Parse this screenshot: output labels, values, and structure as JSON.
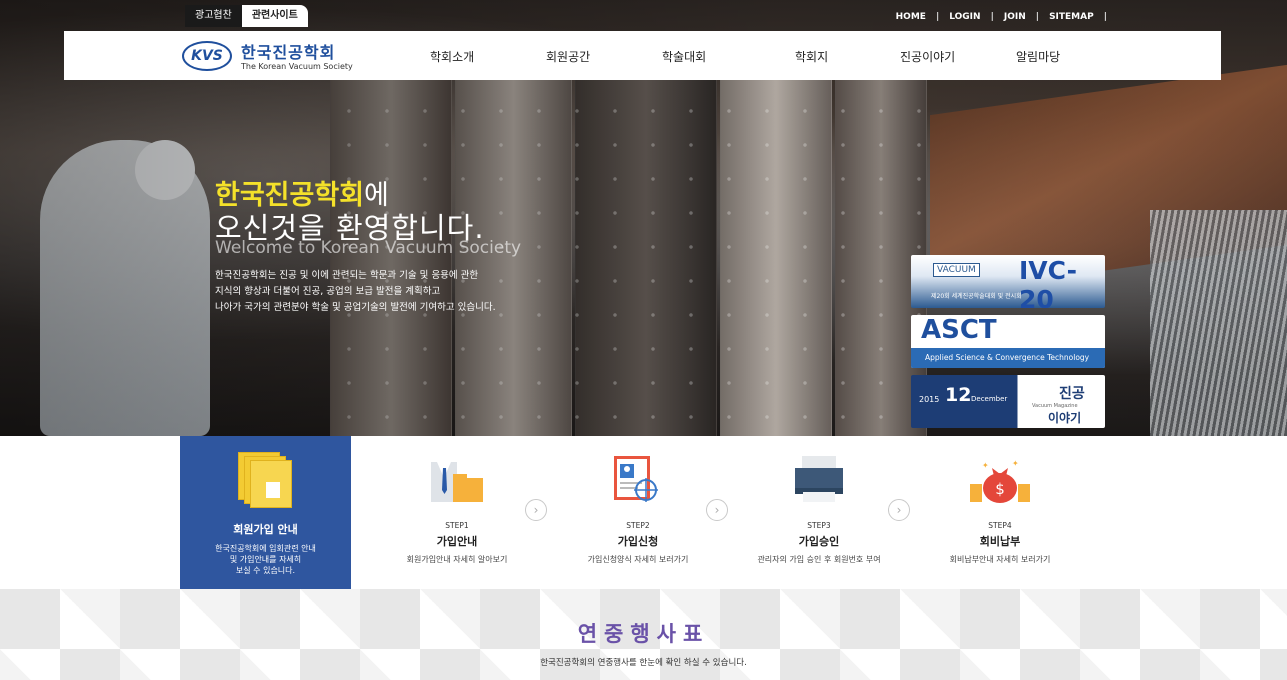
{
  "util_tabs": [
    "광고협찬",
    "관련사이트"
  ],
  "util_links": [
    "HOME",
    "LOGIN",
    "JOIN",
    "SITEMAP"
  ],
  "logo": {
    "badge": "KVS",
    "name_kr": "한국진공학회",
    "name_en": "The Korean Vacuum Society"
  },
  "nav": [
    "학회소개",
    "회원공간",
    "학술대회",
    "학회지",
    "진공이야기",
    "알림마당"
  ],
  "hero": {
    "title_highlight": "한국진공학회",
    "title_rest": "에",
    "title_line2": "오신것을 환영합니다.",
    "subtitle_en": "Welcome to Korean Vacuum Society",
    "desc": [
      "한국진공학회는 진공 및 이에 관련되는 학문과 기술 및 응용에 관한",
      "지식의 향상과 더불어 진공, 공업의 보급 발전을 계획하고",
      "나아가 국가의 관련분야 학술 및 공업기술의 발전에 기여하고 있습니다."
    ],
    "colors": {
      "highlight": "#f4e12a"
    }
  },
  "banners": {
    "ivc": {
      "vacuum": "VACUUM",
      "title": "IVC-20",
      "subtitle": "제20회 세계진공학술대회 및 전시회"
    },
    "asct": {
      "title": "ASCT",
      "subtitle": "Applied Science & Convergence Technology"
    },
    "magazine": {
      "year": "2015",
      "day": "12",
      "month": "December",
      "title_kr": "진공",
      "eng": "Vacuum Magazine",
      "title_kr2": "이야기"
    }
  },
  "join_guide": {
    "title": "회원가입 안내",
    "desc": [
      "한국진공학회에 입회관련 안내",
      "및 가입안내를 자세히",
      "보실 수 있습니다."
    ],
    "color": "#2f569f"
  },
  "steps": [
    {
      "label": "STEP1",
      "title": "가입안내",
      "desc": "회원가입안내 자세히 알아보기"
    },
    {
      "label": "STEP2",
      "title": "가입신청",
      "desc": "가입신청양식 자세히 보러가기"
    },
    {
      "label": "STEP3",
      "title": "가입승인",
      "desc": "관리자의 가입 승인 후 회원번호 부여"
    },
    {
      "label": "STEP4",
      "title": "회비납부",
      "desc": "회비납부안내 자세히 보러가기"
    }
  ],
  "schedule": {
    "title": "연중행사표",
    "desc": "한국진공학회의 연중행사를 한눈에 확인 하실 수 있습니다.",
    "title_color": "#6a52a8"
  }
}
